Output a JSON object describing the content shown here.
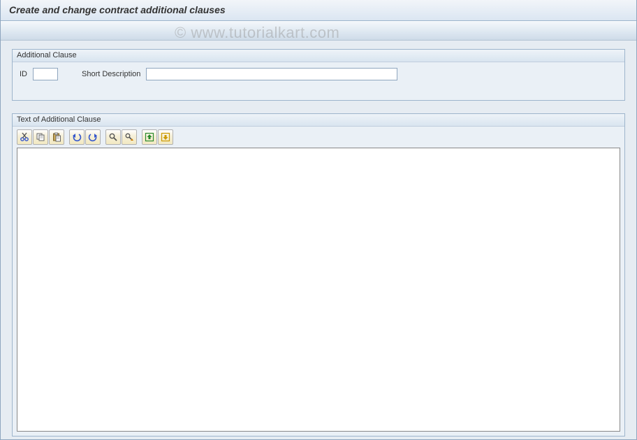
{
  "header": {
    "title": "Create and change contract additional clauses"
  },
  "panel1": {
    "title": "Additional Clause",
    "id_label": "ID",
    "id_value": "",
    "desc_label": "Short Description",
    "desc_value": ""
  },
  "panel2": {
    "title": "Text of Additional Clause",
    "editor_value": ""
  },
  "toolbar": {
    "icons": [
      "cut-icon",
      "copy-icon",
      "paste-icon",
      "undo-icon",
      "redo-icon",
      "find-icon",
      "find-next-icon",
      "upload-icon",
      "download-icon"
    ]
  },
  "watermark": "© www.tutorialkart.com"
}
